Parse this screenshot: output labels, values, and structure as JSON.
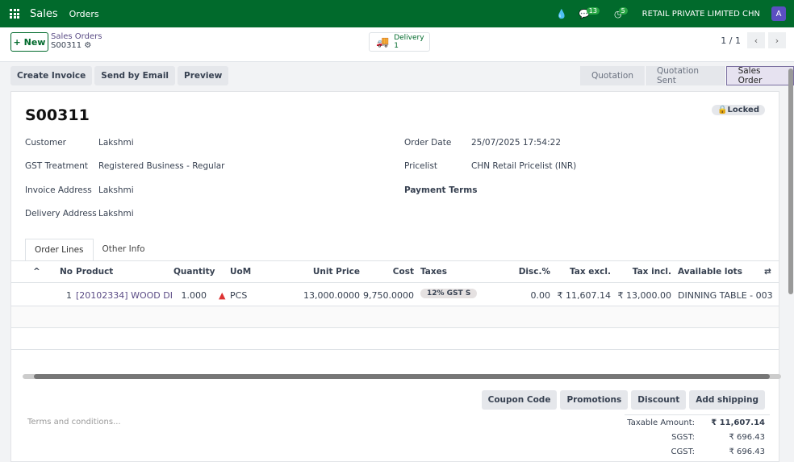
{
  "topbar": {
    "app": "Sales",
    "menu": "Orders",
    "chat_count": "13",
    "activity_count": "5",
    "company": "RETAIL PRIVATE LIMITED CHN",
    "avatar": "A"
  },
  "control": {
    "new_label": "New",
    "breadcrumb_parent": "Sales Orders",
    "breadcrumb_current": "S00311",
    "delivery_label": "Delivery",
    "delivery_count": "1",
    "pager": "1 / 1"
  },
  "actions": [
    "Create Invoice",
    "Send by Email",
    "Preview"
  ],
  "status": [
    "Quotation",
    "Quotation Sent",
    "Sales Order"
  ],
  "form": {
    "title": "S00311",
    "locked": "Locked",
    "customer_label": "Customer",
    "customer": "Lakshmi",
    "gst_label": "GST Treatment",
    "gst": "Registered Business - Regular",
    "invoice_label": "Invoice Address",
    "invoice": "Lakshmi",
    "delivery_label": "Delivery Address",
    "delivery": "Lakshmi",
    "order_date_label": "Order Date",
    "order_date": "25/07/2025 17:54:22",
    "pricelist_label": "Pricelist",
    "pricelist": "CHN Retail Pricelist (INR)",
    "payment_terms_label": "Payment Terms"
  },
  "tabs": [
    "Order Lines",
    "Other Info"
  ],
  "table": {
    "headers": [
      "No",
      "Product",
      "Quantity",
      "UoM",
      "Unit Price",
      "Cost",
      "Taxes",
      "Disc.%",
      "Tax excl.",
      "Tax incl.",
      "Available lots"
    ],
    "rows": [
      {
        "no": "1",
        "product": "[20102334] WOOD DI",
        "qty": "1.000",
        "uom": "PCS",
        "unit_price": "13,000.0000",
        "cost": "9,750.0000",
        "taxes": "12% GST S",
        "disc": "0.00",
        "tax_excl": "₹ 11,607.14",
        "tax_incl": "₹ 13,000.00",
        "lots": "DINNING TABLE - 003"
      }
    ]
  },
  "bottom_buttons": [
    "Coupon Code",
    "Promotions",
    "Discount",
    "Add shipping"
  ],
  "terms_placeholder": "Terms and conditions...",
  "totals": [
    {
      "label": "Taxable Amount:",
      "value": "₹ 11,607.14"
    },
    {
      "label": "SGST:",
      "value": "₹ 696.43"
    },
    {
      "label": "CGST:",
      "value": "₹ 696.43"
    }
  ]
}
